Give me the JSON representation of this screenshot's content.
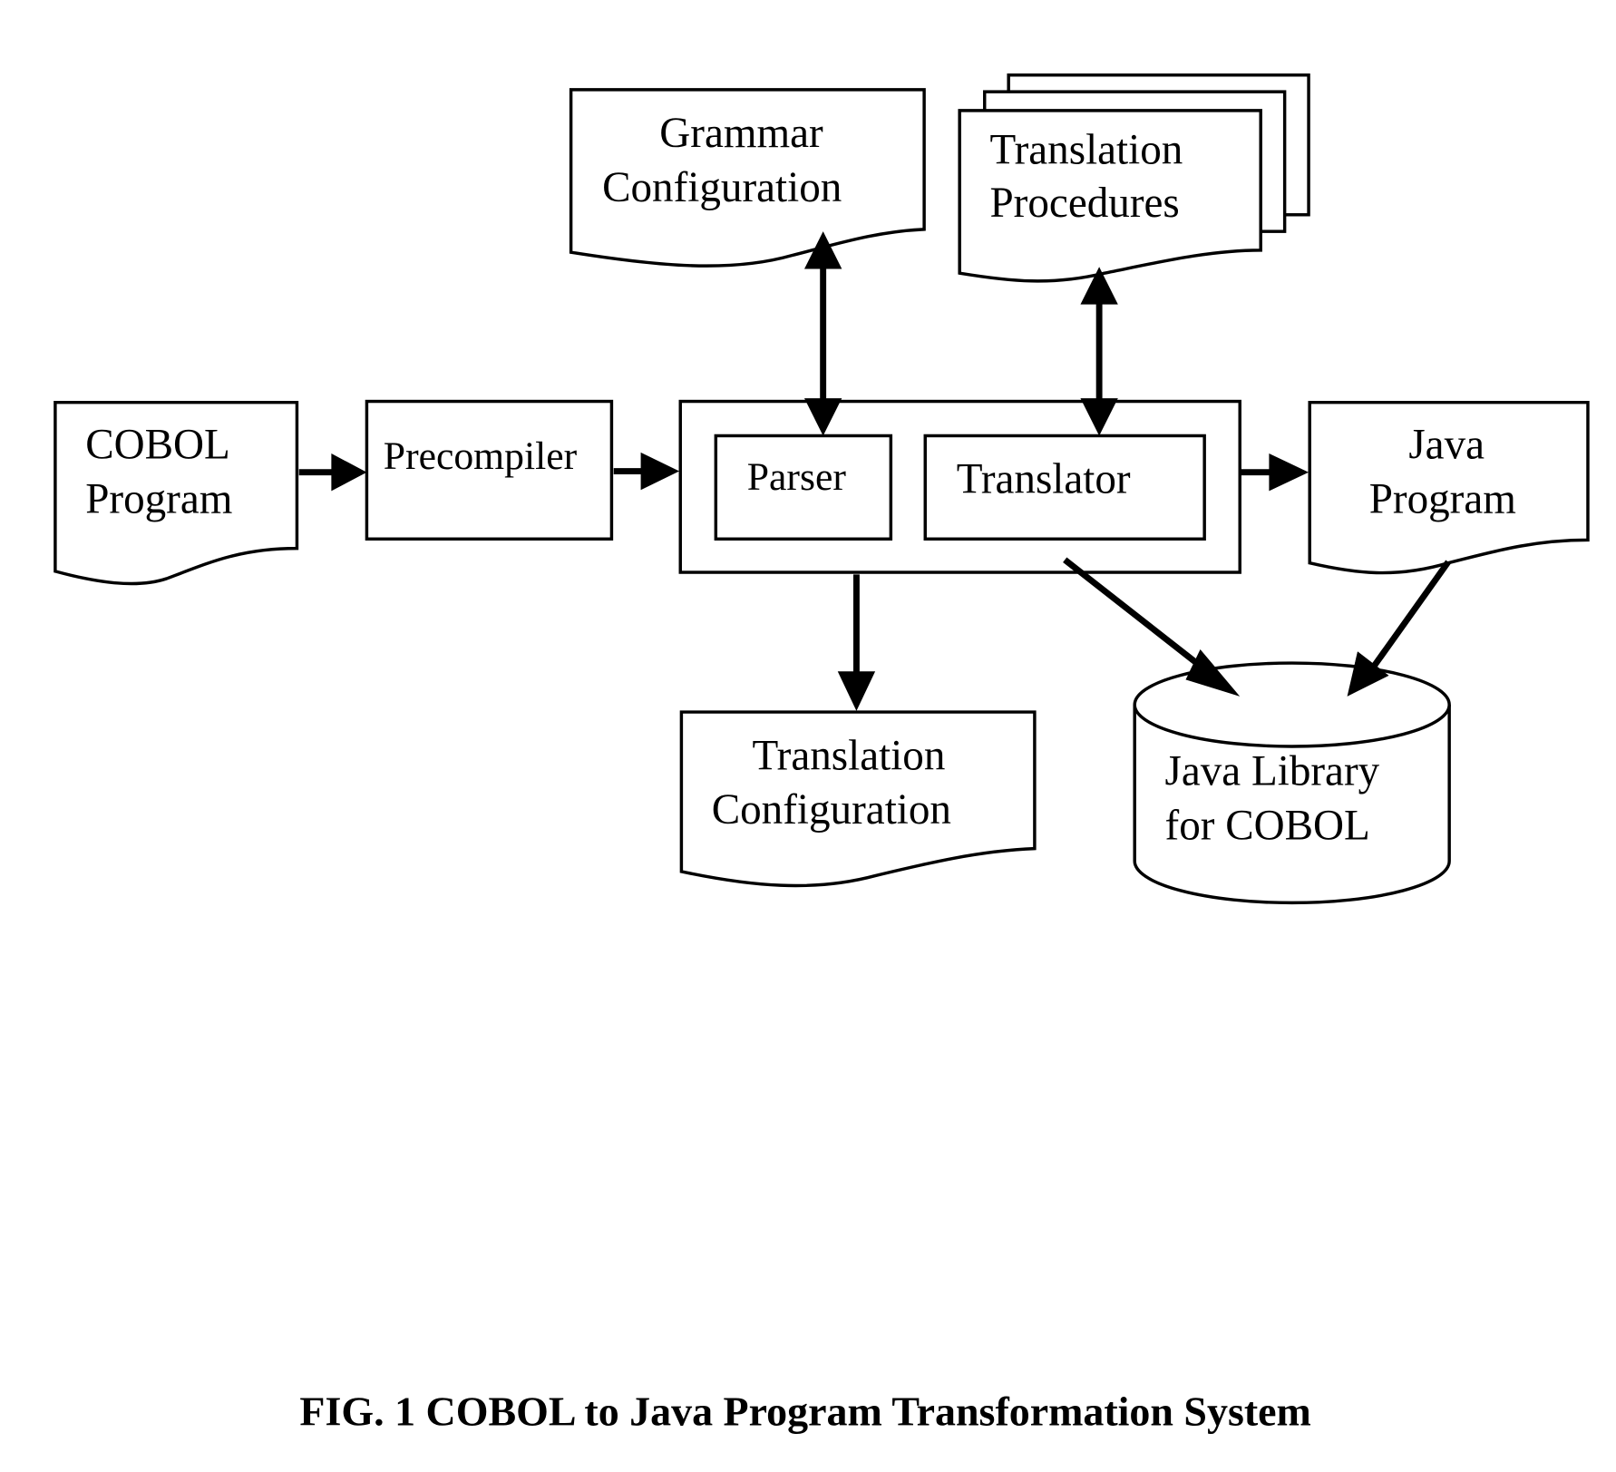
{
  "diagram": {
    "title": "FIG. 1 COBOL to Java Program Transformation System",
    "nodes": {
      "cobol_program": {
        "line1": "COBOL",
        "line2": "Program",
        "shape": "document"
      },
      "precompiler": {
        "label": "Precompiler",
        "shape": "process"
      },
      "parser": {
        "label": "Parser",
        "shape": "process"
      },
      "translator": {
        "label": "Translator",
        "shape": "process"
      },
      "grammar_config": {
        "line1": "Grammar",
        "line2": "Configuration",
        "shape": "document"
      },
      "translation_procedures": {
        "line1": "Translation",
        "line2": "Procedures",
        "shape": "multi-document"
      },
      "java_program": {
        "line1": "Java",
        "line2": "Program",
        "shape": "document"
      },
      "translation_config": {
        "line1": "Translation",
        "line2": "Configuration",
        "shape": "document"
      },
      "java_library": {
        "line1": "Java Library",
        "line2": "for COBOL",
        "shape": "database"
      }
    },
    "edges": [
      {
        "from": "COBOL Program",
        "to": "Precompiler",
        "direction": "forward"
      },
      {
        "from": "Precompiler",
        "to": "Parser/Translator system",
        "direction": "forward"
      },
      {
        "from": "Parser",
        "to": "Grammar Configuration",
        "direction": "bidirectional"
      },
      {
        "from": "Translator",
        "to": "Translation Procedures",
        "direction": "bidirectional"
      },
      {
        "from": "Parser/Translator system",
        "to": "Java Program",
        "direction": "forward"
      },
      {
        "from": "Parser/Translator system",
        "to": "Translation Configuration",
        "direction": "forward"
      },
      {
        "from": "Translator",
        "to": "Java Library for COBOL",
        "direction": "forward"
      },
      {
        "from": "Java Program",
        "to": "Java Library for COBOL",
        "direction": "forward"
      }
    ]
  }
}
